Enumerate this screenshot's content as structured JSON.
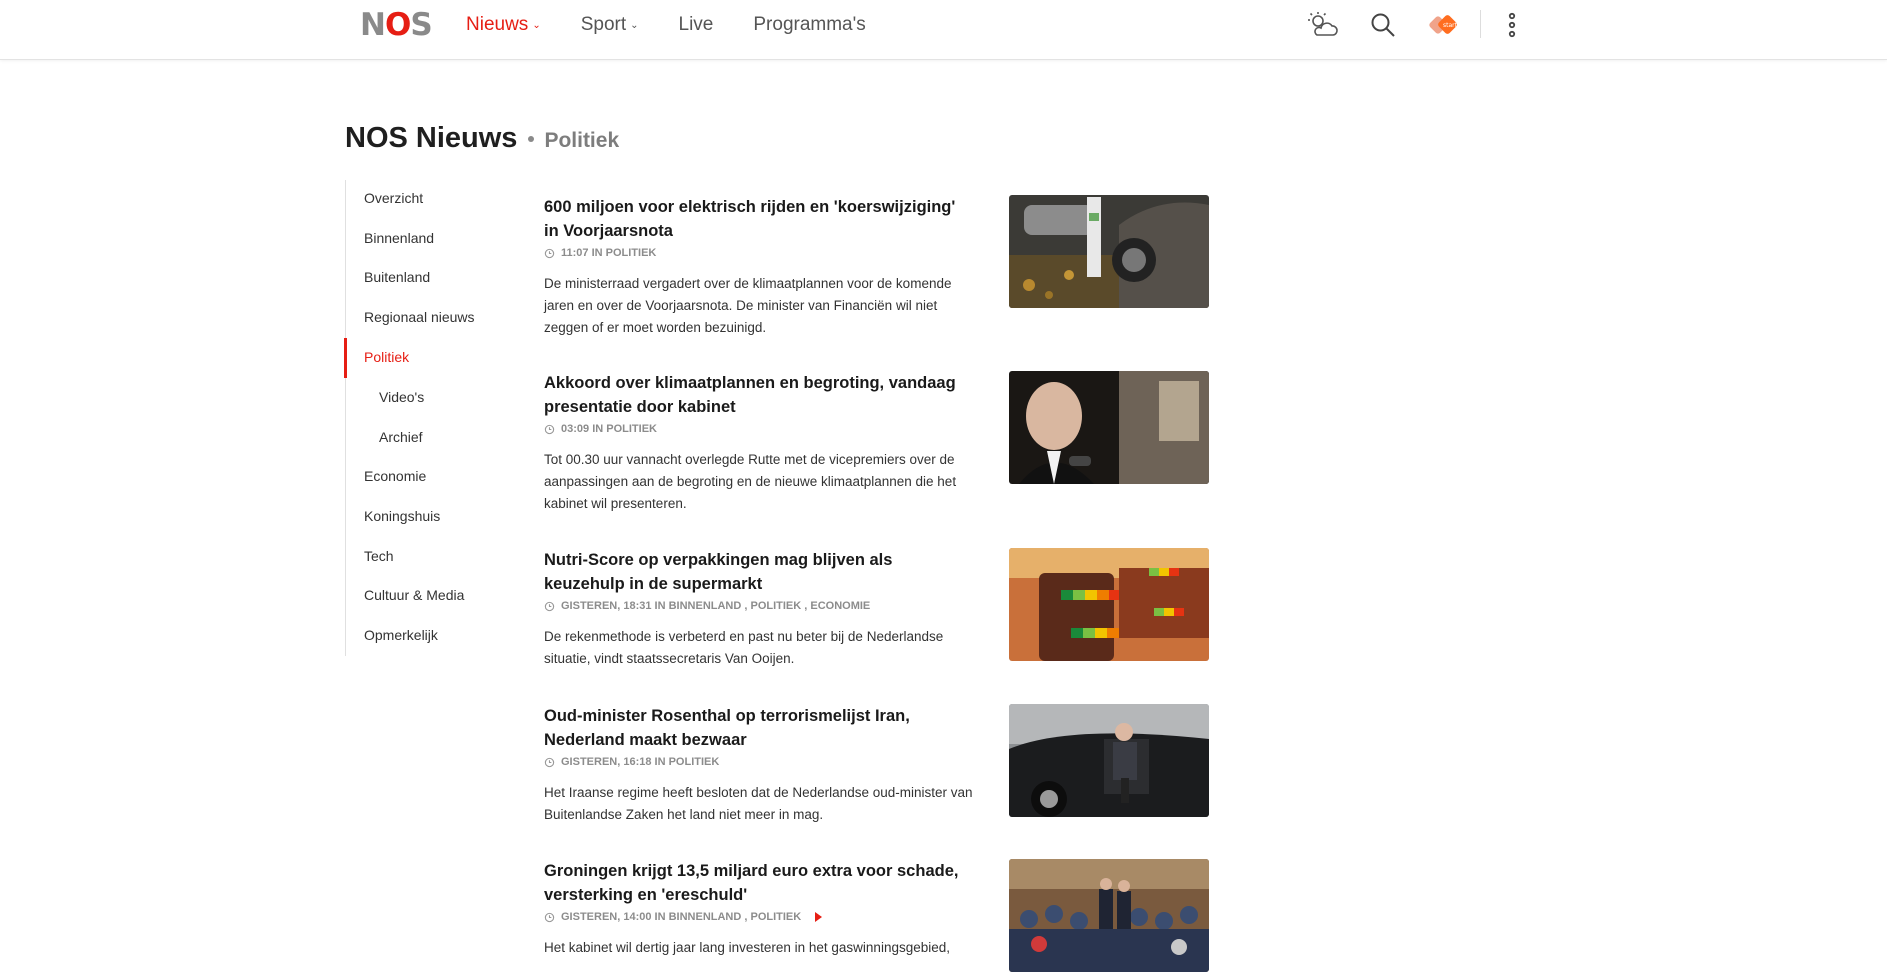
{
  "header": {
    "logo": "NOS",
    "nav": [
      {
        "label": "Nieuws",
        "dropdown": true,
        "active": true
      },
      {
        "label": "Sport",
        "dropdown": true,
        "active": false
      },
      {
        "label": "Live",
        "dropdown": false,
        "active": false
      },
      {
        "label": "Programma's",
        "dropdown": false,
        "active": false
      }
    ],
    "tools": [
      "weather-icon",
      "search-icon",
      "npo-start-icon",
      "more-vertical-icon"
    ],
    "npo_badge": "start",
    "accent": "#e61e14"
  },
  "section": {
    "title": "NOS Nieuws",
    "subtitle": "Politiek"
  },
  "sidebar": {
    "items": [
      {
        "label": "Overzicht"
      },
      {
        "label": "Binnenland"
      },
      {
        "label": "Buitenland"
      },
      {
        "label": "Regionaal nieuws"
      },
      {
        "label": "Politiek",
        "active": true
      },
      {
        "label": "Video's",
        "sub": true
      },
      {
        "label": "Archief",
        "sub": true
      },
      {
        "label": "Economie"
      },
      {
        "label": "Koningshuis"
      },
      {
        "label": "Tech"
      },
      {
        "label": "Cultuur & Media"
      },
      {
        "label": "Opmerkelijk"
      }
    ]
  },
  "articles": [
    {
      "title": "600 miljoen voor elektrisch rijden en 'koerswijziging' in Voorjaarsnota",
      "meta": "11:07 IN POLITIEK",
      "description": "De ministerraad vergadert over de klimaatplannen voor de komende jaren en over de Voorjaarsnota. De minister van Financiën wil niet zeggen of er moet worden bezuinigd."
    },
    {
      "title": "Akkoord over klimaatplannen en begroting, vandaag presentatie door kabinet",
      "meta": "03:09 IN POLITIEK",
      "description": "Tot 00.30 uur vannacht overlegde Rutte met de vicepremiers over de aanpassingen aan de begroting en de nieuwe klimaatplannen die het kabinet wil presenteren."
    },
    {
      "title": "Nutri-Score op verpakkingen mag blijven als keuzehulp in de supermarkt",
      "meta": "GISTEREN, 18:31 IN BINNENLAND , POLITIEK , ECONOMIE",
      "description": "De rekenmethode is verbeterd en past nu beter bij de Nederlandse situatie, vindt staatssecretaris Van Ooijen."
    },
    {
      "title": "Oud-minister Rosenthal op terrorismelijst Iran, Nederland maakt bezwaar",
      "meta": "GISTEREN, 16:18 IN POLITIEK",
      "description": "Het Iraanse regime heeft besloten dat de Nederlandse oud-minister van Buitenlandse Zaken het land niet meer in mag."
    },
    {
      "title": "Groningen krijgt 13,5 miljard euro extra voor schade, versterking en 'ereschuld'",
      "meta": "GISTEREN, 14:00 IN BINNENLAND , POLITIEK",
      "has_video": true,
      "description": "Het kabinet wil dertig jaar lang investeren in het gaswinningsgebied,"
    }
  ]
}
